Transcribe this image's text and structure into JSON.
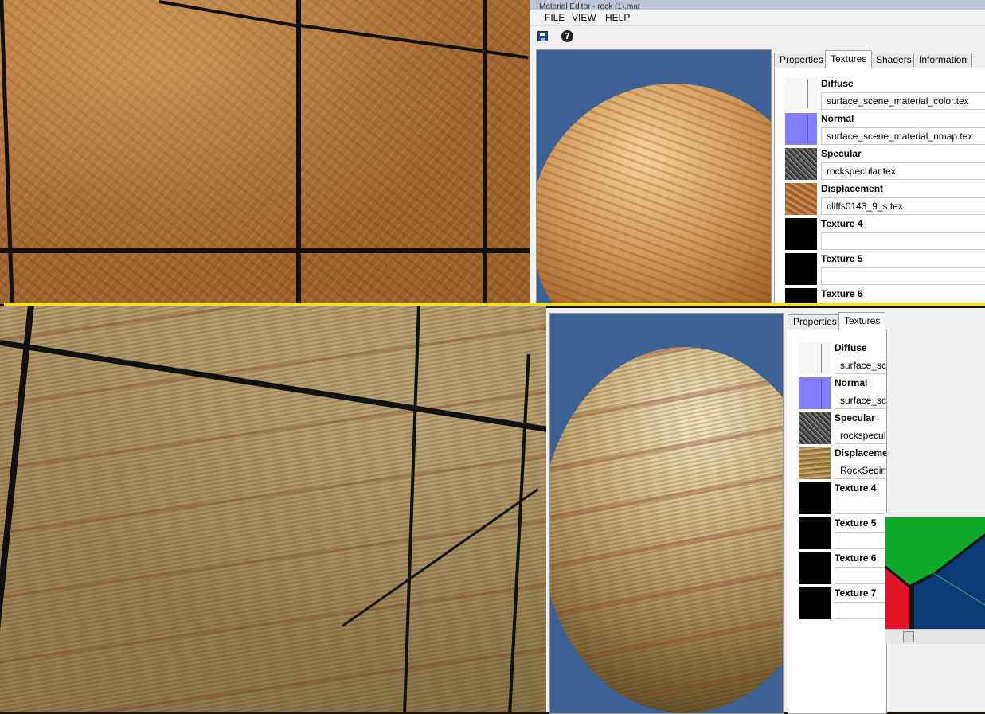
{
  "top_editor": {
    "window_title": "Material Editor - rock (1).mat",
    "menu": [
      "FILE",
      "VIEW",
      "HELP"
    ],
    "toolbar": {
      "save_icon": "save-icon",
      "help_icon": "help-icon",
      "help_glyph": "?"
    },
    "tabs": [
      "Properties",
      "Textures",
      "Shaders",
      "Information"
    ],
    "active_tab": "Textures",
    "slots": [
      {
        "label": "Diffuse",
        "file": "surface_scene_material_color.tex"
      },
      {
        "label": "Normal",
        "file": "surface_scene_material_nmap.tex"
      },
      {
        "label": "Specular",
        "file": "rockspecular.tex"
      },
      {
        "label": "Displacement",
        "file": "cliffs0143_9_s.tex"
      },
      {
        "label": "Texture 4",
        "file": ""
      },
      {
        "label": "Texture 5",
        "file": ""
      },
      {
        "label": "Texture 6",
        "file": ""
      }
    ]
  },
  "bottom_editor": {
    "tabs": [
      "Properties",
      "Textures"
    ],
    "active_tab": "Textures",
    "slots": [
      {
        "label": "Diffuse",
        "file": "surface_sce"
      },
      {
        "label": "Normal",
        "file": "surface_sce"
      },
      {
        "label": "Specular",
        "file": "rockspecul"
      },
      {
        "label": "Displaceme",
        "file": "RockSedim"
      },
      {
        "label": "Texture 4",
        "file": ""
      },
      {
        "label": "Texture 5",
        "file": ""
      },
      {
        "label": "Texture 6",
        "file": ""
      },
      {
        "label": "Texture 7",
        "file": ""
      }
    ]
  },
  "colors": {
    "separator": "#f5e400",
    "normal_map": "#8080ff",
    "preview_background": "#3c6194"
  }
}
